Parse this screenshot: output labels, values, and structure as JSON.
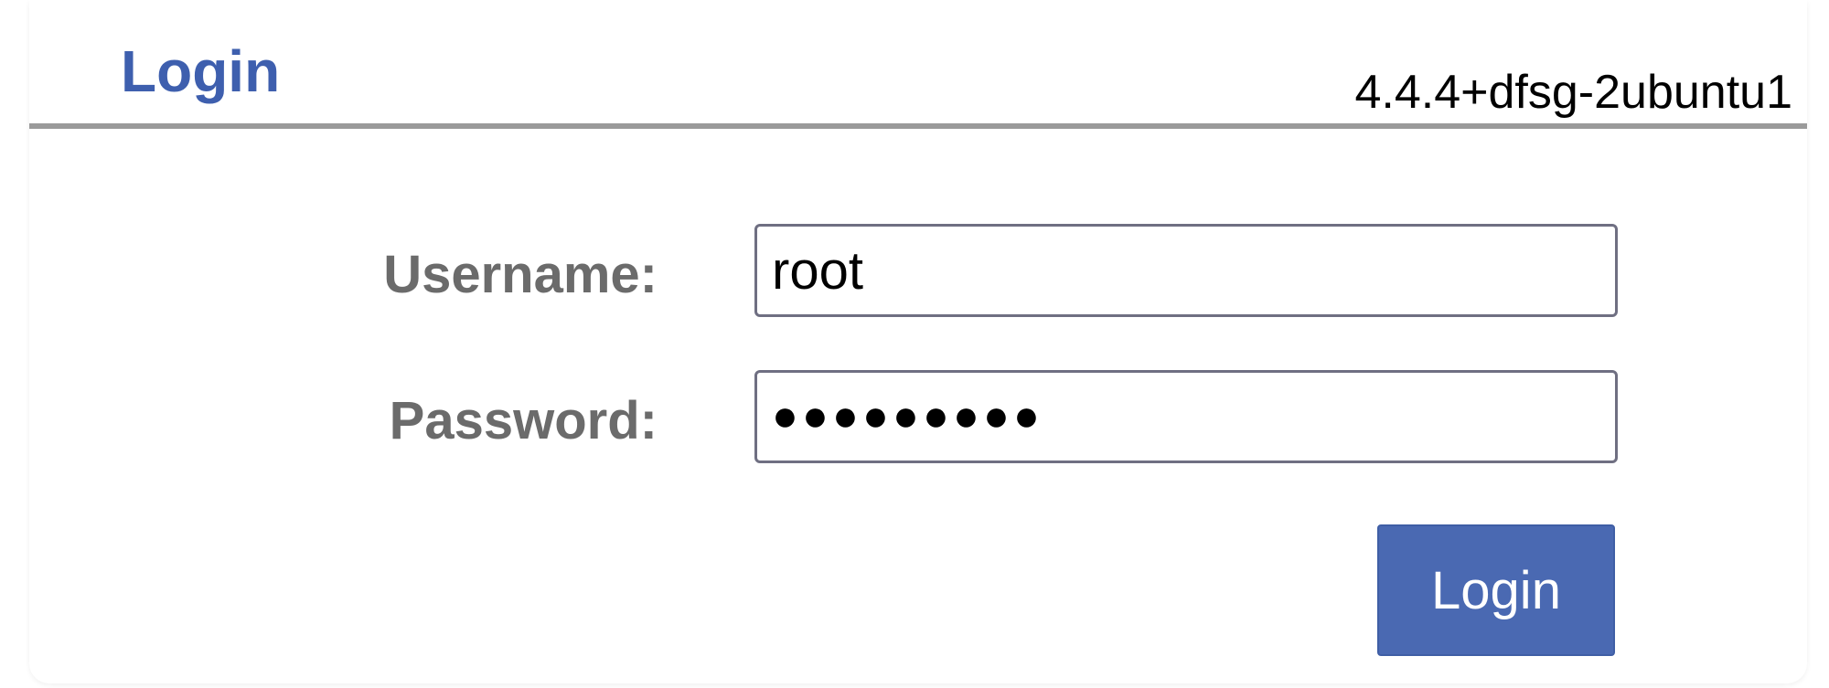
{
  "header": {
    "title": "Login",
    "version": "4.4.4+dfsg-2ubuntu1"
  },
  "form": {
    "username_label": "Username:",
    "username_value": "root",
    "password_label": "Password:",
    "password_masked": "●●●●●●●●●",
    "submit_label": "Login"
  },
  "colors": {
    "accent": "#4a69b2",
    "title": "#3e5fae",
    "label": "#6b6b6b"
  }
}
